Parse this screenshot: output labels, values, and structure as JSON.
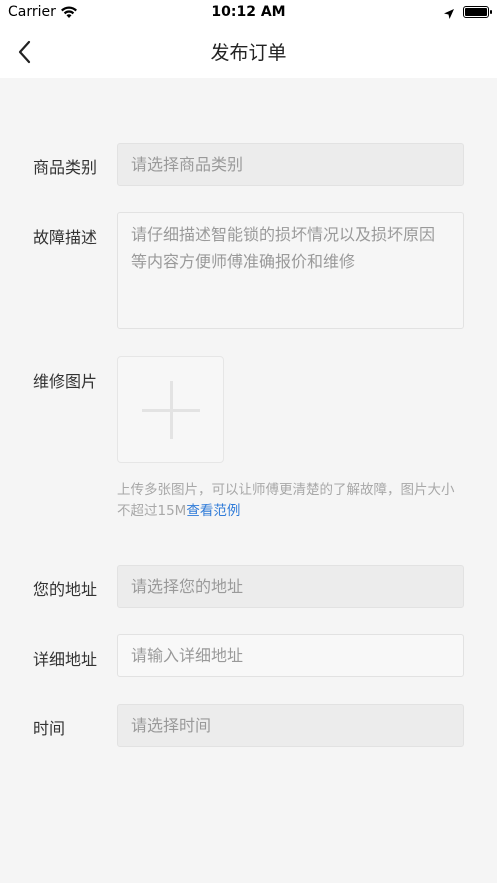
{
  "status_bar": {
    "carrier": "Carrier",
    "time": "10:12 AM"
  },
  "nav": {
    "title": "发布订单"
  },
  "form": {
    "category": {
      "label": "商品类别",
      "placeholder": "请选择商品类别"
    },
    "fault": {
      "label": "故障描述",
      "placeholder": "请仔细描述智能锁的损坏情况以及损坏原因等内容方便师傅准确报价和维修"
    },
    "photos": {
      "label": "维修图片",
      "hint": "上传多张图片，可以让师傅更清楚的了解故障，图片大小不超过15M",
      "example_link": "查看范例"
    },
    "address": {
      "label": "您的地址",
      "placeholder": "请选择您的地址"
    },
    "detail_address": {
      "label": "详细地址",
      "placeholder": "请输入详细地址"
    },
    "time": {
      "label": "时间",
      "placeholder": "请选择时间"
    }
  },
  "colors": {
    "background": "#f5f5f5",
    "link": "#2f7bd8",
    "placeholder": "#9a9a9a"
  }
}
